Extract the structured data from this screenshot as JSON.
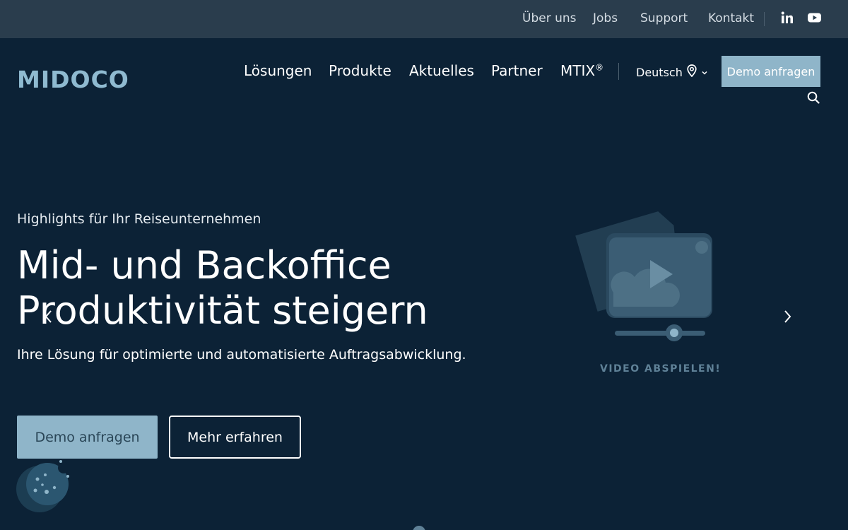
{
  "topbar": {
    "links": [
      "Über uns",
      "Jobs",
      "Support",
      "Kontakt"
    ]
  },
  "header": {
    "logo": "MIDOCO",
    "nav": [
      "Lösungen",
      "Produkte",
      "Aktuelles",
      "Partner"
    ],
    "mtix": "MTIX",
    "mtix_sup": "®",
    "language": "Deutsch",
    "demo_button": "Demo anfragen"
  },
  "hero": {
    "eyebrow": "Highlights für Ihr Reiseunternehmen",
    "title_line1": "Mid- und Backoffice",
    "title_line2": "Produktivität steigern",
    "subtitle": "Ihre Lösung für optimierte und automatisierte Auftragsabwicklung.",
    "primary_button": "Demo anfragen",
    "secondary_button": "Mehr erfahren",
    "video_label": "VIDEO ABSPIELEN!"
  },
  "colors": {
    "background": "#0c2236",
    "topbar": "#2a3d4d",
    "accent": "#8fb5c9"
  },
  "icons": [
    "linkedin-icon",
    "youtube-icon",
    "location-pin-icon",
    "chevron-down-icon",
    "search-icon",
    "chevron-left-icon",
    "chevron-right-icon",
    "video-play-icon",
    "cookie-icon"
  ]
}
